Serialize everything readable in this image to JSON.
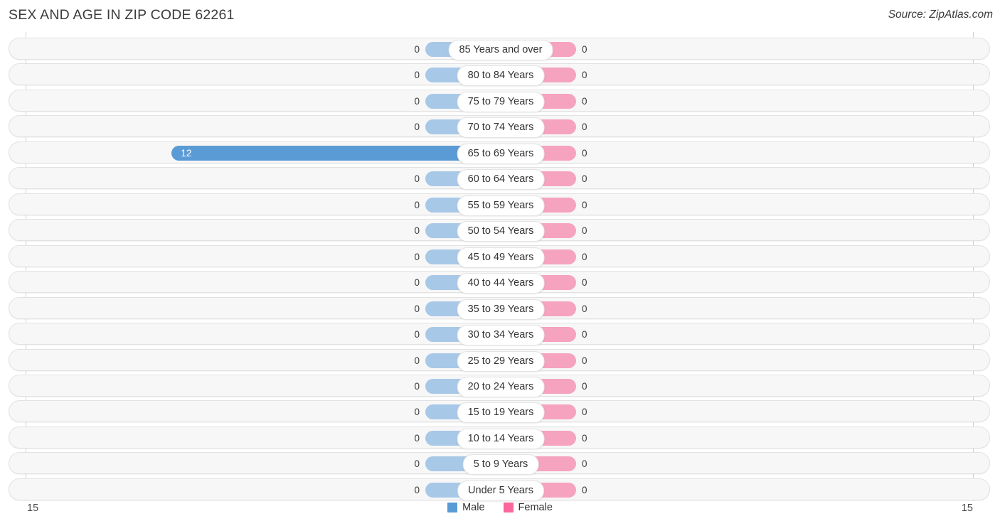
{
  "header": {
    "title": "SEX AND AGE IN ZIP CODE 62261",
    "source": "Source: ZipAtlas.com"
  },
  "legend": {
    "male": {
      "label": "Male",
      "color": "#5b9bd5"
    },
    "female": {
      "label": "Female",
      "color": "#f9679c"
    }
  },
  "axis": {
    "left_tick": "15",
    "right_tick": "15",
    "max": 15
  },
  "colors": {
    "male_fill": "#5b9bd5",
    "male_empty": "#a8c8e8",
    "female_fill": "#f9679c",
    "female_empty": "#f5a3be",
    "row_bg": "#f7f7f7",
    "row_border": "#e2e2e2"
  },
  "chart_data": {
    "type": "bar",
    "title": "SEX AND AGE IN ZIP CODE 62261",
    "subtitle": "Source: ZipAtlas.com",
    "orientation": "horizontal",
    "style": "population-pyramid",
    "xlabel": "",
    "ylabel": "",
    "xlim": [
      15,
      15
    ],
    "grid": false,
    "legend_position": "bottom-center",
    "categories": [
      "85 Years and over",
      "80 to 84 Years",
      "75 to 79 Years",
      "70 to 74 Years",
      "65 to 69 Years",
      "60 to 64 Years",
      "55 to 59 Years",
      "50 to 54 Years",
      "45 to 49 Years",
      "40 to 44 Years",
      "35 to 39 Years",
      "30 to 34 Years",
      "25 to 29 Years",
      "20 to 24 Years",
      "15 to 19 Years",
      "10 to 14 Years",
      "5 to 9 Years",
      "Under 5 Years"
    ],
    "series": [
      {
        "name": "Male",
        "color": "#5b9bd5",
        "direction": "left",
        "values": [
          0,
          0,
          0,
          0,
          12,
          0,
          0,
          0,
          0,
          0,
          0,
          0,
          0,
          0,
          0,
          0,
          0,
          0
        ],
        "labels": [
          "0",
          "0",
          "0",
          "0",
          "12",
          "0",
          "0",
          "0",
          "0",
          "0",
          "0",
          "0",
          "0",
          "0",
          "0",
          "0",
          "0",
          "0"
        ]
      },
      {
        "name": "Female",
        "color": "#f9679c",
        "direction": "right",
        "values": [
          0,
          0,
          0,
          0,
          0,
          0,
          0,
          0,
          0,
          0,
          0,
          0,
          0,
          0,
          0,
          0,
          0,
          0
        ],
        "labels": [
          "0",
          "0",
          "0",
          "0",
          "0",
          "0",
          "0",
          "0",
          "0",
          "0",
          "0",
          "0",
          "0",
          "0",
          "0",
          "0",
          "0",
          "0"
        ]
      }
    ]
  }
}
